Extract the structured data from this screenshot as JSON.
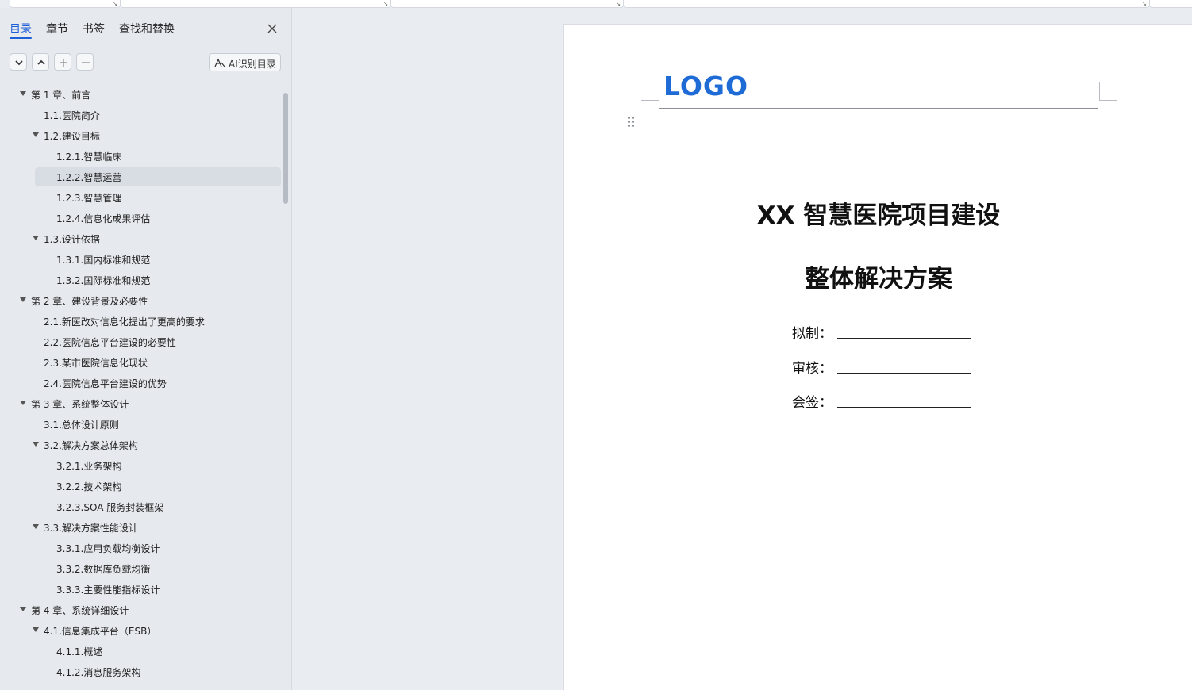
{
  "sidebar": {
    "tabs": [
      {
        "label": "目录"
      },
      {
        "label": "章节"
      },
      {
        "label": "书签"
      },
      {
        "label": "查找和替换"
      }
    ],
    "ai_button_label": "AI识别目录",
    "toc": [
      {
        "label": "第 1 章、前言"
      },
      {
        "label": "1.1.医院简介"
      },
      {
        "label": "1.2.建设目标"
      },
      {
        "label": "1.2.1.智慧临床"
      },
      {
        "label": "1.2.2.智慧运营"
      },
      {
        "label": "1.2.3.智慧管理"
      },
      {
        "label": "1.2.4.信息化成果评估"
      },
      {
        "label": "1.3.设计依据"
      },
      {
        "label": "1.3.1.国内标准和规范"
      },
      {
        "label": "1.3.2.国际标准和规范"
      },
      {
        "label": "第 2 章、建设背景及必要性"
      },
      {
        "label": "2.1.新医改对信息化提出了更高的要求"
      },
      {
        "label": "2.2.医院信息平台建设的必要性"
      },
      {
        "label": "2.3.某市医院信息化现状"
      },
      {
        "label": "2.4.医院信息平台建设的优势"
      },
      {
        "label": "第 3 章、系统整体设计"
      },
      {
        "label": "3.1.总体设计原则"
      },
      {
        "label": "3.2.解决方案总体架构"
      },
      {
        "label": "3.2.1.业务架构"
      },
      {
        "label": "3.2.2.技术架构"
      },
      {
        "label": "3.2.3.SOA 服务封装框架"
      },
      {
        "label": "3.3.解决方案性能设计"
      },
      {
        "label": "3.3.1.应用负载均衡设计"
      },
      {
        "label": "3.3.2.数据库负载均衡"
      },
      {
        "label": "3.3.3.主要性能指标设计"
      },
      {
        "label": "第 4 章、系统详细设计"
      },
      {
        "label": "4.1.信息集成平台（ESB）"
      },
      {
        "label": "4.1.1.概述"
      },
      {
        "label": "4.1.2.消息服务架构"
      }
    ]
  },
  "document": {
    "logo_text": "LOGO",
    "title_line1": "XX 智慧医院项目建设",
    "title_line2": "整体解决方案",
    "sign_fields": [
      {
        "label": "拟制："
      },
      {
        "label": "审核："
      },
      {
        "label": "会签："
      }
    ]
  },
  "colors": {
    "accent": "#1d5fd6",
    "logo": "#1e6bd6",
    "sidebar_bg": "#e6eaef",
    "selected_row": "#d8dce3"
  }
}
